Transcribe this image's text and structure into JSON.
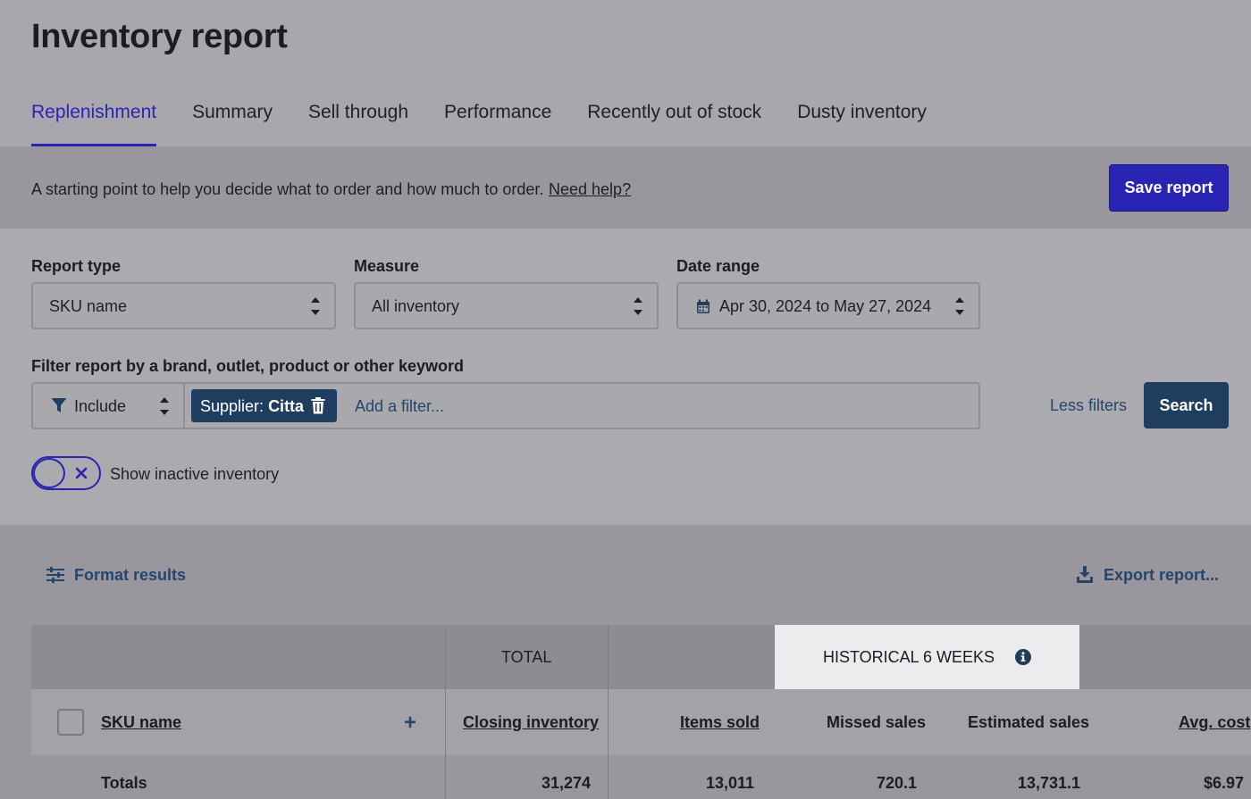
{
  "header": {
    "title": "Inventory report",
    "tabs": [
      {
        "label": "Replenishment",
        "active": true
      },
      {
        "label": "Summary",
        "active": false
      },
      {
        "label": "Sell through",
        "active": false
      },
      {
        "label": "Performance",
        "active": false
      },
      {
        "label": "Recently out of stock",
        "active": false
      },
      {
        "label": "Dusty inventory",
        "active": false
      }
    ]
  },
  "infobar": {
    "text": "A starting point to help you decide what to order and how much to order.",
    "help_link": "Need help?",
    "save_label": "Save report"
  },
  "filters": {
    "report_type": {
      "label": "Report type",
      "value": "SKU name"
    },
    "measure": {
      "label": "Measure",
      "value": "All inventory"
    },
    "date_range": {
      "label": "Date range",
      "value": "Apr 30, 2024 to May 27, 2024"
    },
    "keyword_label": "Filter report by a brand, outlet, product or other keyword",
    "include_value": "Include",
    "chip": {
      "prefix": "Supplier:",
      "value": "Citta"
    },
    "add_placeholder": "Add a filter...",
    "less_filters": "Less filters",
    "search_label": "Search",
    "show_inactive_label": "Show inactive inventory",
    "show_inactive": false
  },
  "results": {
    "format_label": "Format results",
    "export_label": "Export report...",
    "groups": {
      "total": "TOTAL",
      "historical": "HISTORICAL 6 WEEKS"
    },
    "columns": {
      "sku": "SKU name",
      "closing": "Closing inventory",
      "items_sold": "Items sold",
      "missed": "Missed sales",
      "estimated": "Estimated sales",
      "avg_cost": "Avg. cost"
    },
    "totals": {
      "label": "Totals",
      "closing": "31,274",
      "items_sold": "13,011",
      "missed": "720.1",
      "estimated": "13,731.1",
      "avg_cost": "$6.97"
    }
  },
  "colors": {
    "accent": "#2a24b3",
    "navy": "#1f3d5e",
    "link": "#25456b"
  }
}
